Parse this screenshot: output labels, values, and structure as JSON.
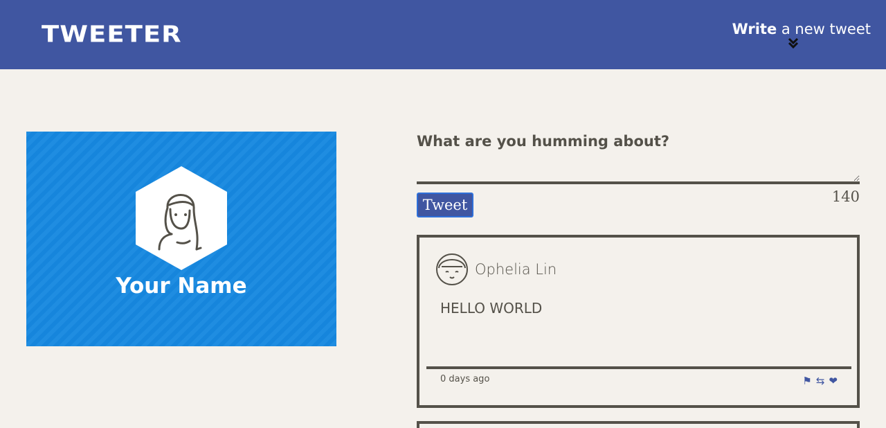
{
  "nav": {
    "brand": "TWEETER",
    "compose_bold": "Write",
    "compose_rest": " a new tweet"
  },
  "profile": {
    "name": "Your Name"
  },
  "compose": {
    "label": "What are you humming about?",
    "button": "Tweet",
    "counter": "140"
  },
  "tweets": [
    {
      "author": "Ophelia Lin",
      "text": "HELLO WORLD",
      "timestamp": "0 days ago",
      "actions": [
        "flag-icon",
        "retweet-icon",
        "heart-icon"
      ]
    }
  ],
  "colors": {
    "nav": "#4056a1",
    "profile": "#1688e0",
    "text": "#545149",
    "background": "#f4f1ec"
  }
}
